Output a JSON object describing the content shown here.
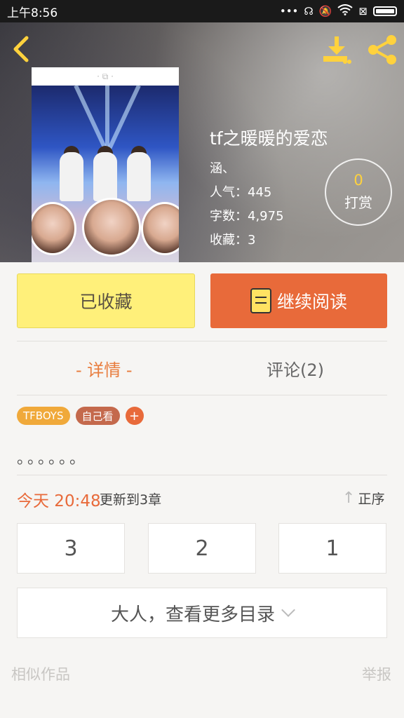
{
  "status_bar": {
    "time": "上午8:56"
  },
  "book": {
    "title": "tf之暖暖的爱恋",
    "author": "涵、",
    "meta": [
      {
        "key": "人气",
        "value": "445"
      },
      {
        "key": "字数",
        "value": "4,975"
      },
      {
        "key": "收藏",
        "value": "3"
      }
    ]
  },
  "reward": {
    "count": "0",
    "label": "打赏"
  },
  "actions": {
    "collect": "已收藏",
    "read": "继续阅读"
  },
  "tabs": {
    "detail": "- 详情 -",
    "comment": "评论(2)"
  },
  "tags": [
    "TFBOYS",
    "自己看",
    "+"
  ],
  "description": "。。。。。。",
  "update": {
    "time": "今天 20:48",
    "text": "更新到3章",
    "sort": "正序"
  },
  "chapters": [
    "3",
    "2",
    "1"
  ],
  "more_catalog": "大人，查看更多目录",
  "footer": {
    "similar": "相似作品",
    "report": "举报"
  },
  "colors": {
    "accent": "#e86a3a",
    "collect_bg": "#fff07a",
    "reward_number": "#ffd23d"
  }
}
